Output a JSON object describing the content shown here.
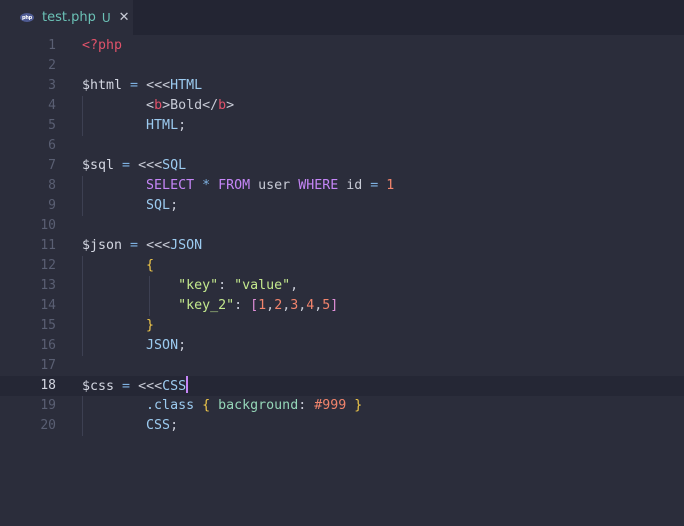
{
  "tab": {
    "icon": "php-file-icon",
    "icon_text": "php",
    "filename": "test.php",
    "status": "U",
    "close": "✕"
  },
  "editor": {
    "current_line": 18,
    "lines": [
      {
        "n": "1",
        "tokens": [
          {
            "t": "<?php",
            "c": "tag"
          }
        ]
      },
      {
        "n": "2",
        "tokens": []
      },
      {
        "n": "3",
        "tokens": [
          {
            "t": "$html",
            "c": "var"
          },
          {
            "t": " = ",
            "c": "op"
          },
          {
            "t": "<<<",
            "c": "plain"
          },
          {
            "t": "HTML",
            "c": "heredoc"
          }
        ]
      },
      {
        "n": "4",
        "tokens": [
          {
            "t": "        ",
            "c": "plain"
          },
          {
            "t": "<",
            "c": "plain"
          },
          {
            "t": "b",
            "c": "tag"
          },
          {
            "t": ">",
            "c": "plain"
          },
          {
            "t": "Bold",
            "c": "plain"
          },
          {
            "t": "</",
            "c": "plain"
          },
          {
            "t": "b",
            "c": "tag"
          },
          {
            "t": ">",
            "c": "plain"
          }
        ]
      },
      {
        "n": "5",
        "tokens": [
          {
            "t": "        ",
            "c": "plain"
          },
          {
            "t": "HTML",
            "c": "heredoc"
          },
          {
            "t": ";",
            "c": "plain"
          }
        ]
      },
      {
        "n": "6",
        "tokens": []
      },
      {
        "n": "7",
        "tokens": [
          {
            "t": "$sql",
            "c": "var"
          },
          {
            "t": " = ",
            "c": "op"
          },
          {
            "t": "<<<",
            "c": "plain"
          },
          {
            "t": "SQL",
            "c": "heredoc"
          }
        ]
      },
      {
        "n": "8",
        "tokens": [
          {
            "t": "        ",
            "c": "plain"
          },
          {
            "t": "SELECT",
            "c": "kw"
          },
          {
            "t": " * ",
            "c": "op"
          },
          {
            "t": "FROM",
            "c": "kw"
          },
          {
            "t": " user ",
            "c": "plain"
          },
          {
            "t": "WHERE",
            "c": "kw"
          },
          {
            "t": " id ",
            "c": "plain"
          },
          {
            "t": "=",
            "c": "op"
          },
          {
            "t": " ",
            "c": "plain"
          },
          {
            "t": "1",
            "c": "num"
          }
        ]
      },
      {
        "n": "9",
        "tokens": [
          {
            "t": "        ",
            "c": "plain"
          },
          {
            "t": "SQL",
            "c": "heredoc"
          },
          {
            "t": ";",
            "c": "plain"
          }
        ]
      },
      {
        "n": "10",
        "tokens": []
      },
      {
        "n": "11",
        "tokens": [
          {
            "t": "$json",
            "c": "var"
          },
          {
            "t": " = ",
            "c": "op"
          },
          {
            "t": "<<<",
            "c": "plain"
          },
          {
            "t": "JSON",
            "c": "heredoc"
          }
        ]
      },
      {
        "n": "12",
        "tokens": [
          {
            "t": "        ",
            "c": "plain"
          },
          {
            "t": "{",
            "c": "brace"
          }
        ]
      },
      {
        "n": "13",
        "tokens": [
          {
            "t": "            ",
            "c": "plain"
          },
          {
            "t": "\"key\"",
            "c": "str"
          },
          {
            "t": ": ",
            "c": "plain"
          },
          {
            "t": "\"value\"",
            "c": "str"
          },
          {
            "t": ",",
            "c": "plain"
          }
        ]
      },
      {
        "n": "14",
        "tokens": [
          {
            "t": "            ",
            "c": "plain"
          },
          {
            "t": "\"key_2\"",
            "c": "str"
          },
          {
            "t": ": ",
            "c": "plain"
          },
          {
            "t": "[",
            "c": "bracket"
          },
          {
            "t": "1",
            "c": "num"
          },
          {
            "t": ",",
            "c": "plain"
          },
          {
            "t": "2",
            "c": "num"
          },
          {
            "t": ",",
            "c": "plain"
          },
          {
            "t": "3",
            "c": "num"
          },
          {
            "t": ",",
            "c": "plain"
          },
          {
            "t": "4",
            "c": "num"
          },
          {
            "t": ",",
            "c": "plain"
          },
          {
            "t": "5",
            "c": "num"
          },
          {
            "t": "]",
            "c": "bracket"
          }
        ]
      },
      {
        "n": "15",
        "tokens": [
          {
            "t": "        ",
            "c": "plain"
          },
          {
            "t": "}",
            "c": "brace"
          }
        ]
      },
      {
        "n": "16",
        "tokens": [
          {
            "t": "        ",
            "c": "plain"
          },
          {
            "t": "JSON",
            "c": "heredoc"
          },
          {
            "t": ";",
            "c": "plain"
          }
        ]
      },
      {
        "n": "17",
        "tokens": []
      },
      {
        "n": "18",
        "tokens": [
          {
            "t": "$css",
            "c": "var"
          },
          {
            "t": " = ",
            "c": "op"
          },
          {
            "t": "<<<",
            "c": "plain"
          },
          {
            "t": "CSS",
            "c": "heredoc"
          }
        ]
      },
      {
        "n": "19",
        "tokens": [
          {
            "t": "        ",
            "c": "plain"
          },
          {
            "t": ".class",
            "c": "class"
          },
          {
            "t": " ",
            "c": "plain"
          },
          {
            "t": "{",
            "c": "brace"
          },
          {
            "t": " ",
            "c": "plain"
          },
          {
            "t": "background",
            "c": "prop"
          },
          {
            "t": ": ",
            "c": "plain"
          },
          {
            "t": "#999",
            "c": "num"
          },
          {
            "t": " ",
            "c": "plain"
          },
          {
            "t": "}",
            "c": "brace"
          }
        ]
      },
      {
        "n": "20",
        "tokens": [
          {
            "t": "        ",
            "c": "plain"
          },
          {
            "t": "CSS",
            "c": "heredoc"
          },
          {
            "t": ";",
            "c": "plain"
          }
        ]
      }
    ]
  }
}
